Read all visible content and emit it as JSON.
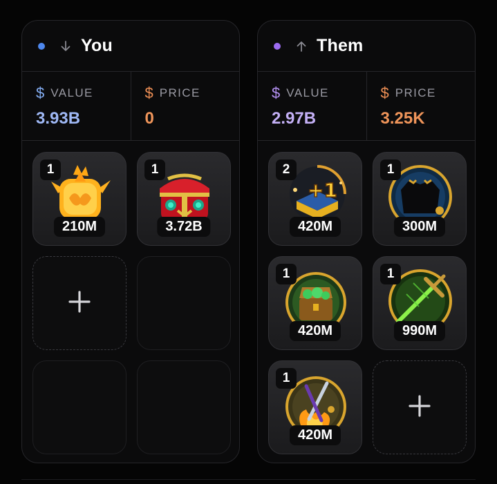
{
  "you": {
    "title": "You",
    "dot_color": "#4e88ee",
    "arrow_icon": "arrow-down-icon",
    "value_label": "VALUE",
    "price_label": "PRICE",
    "currency_symbol": "$",
    "value": "3.93B",
    "price": "0",
    "items": [
      {
        "qty": "1",
        "value": "210M",
        "icon": "flame-fruit-icon"
      },
      {
        "qty": "1",
        "value": "3.72B",
        "icon": "red-chest-icon"
      }
    ]
  },
  "them": {
    "title": "Them",
    "dot_color": "#9d6cf2",
    "arrow_icon": "arrow-up-icon",
    "value_label": "VALUE",
    "price_label": "PRICE",
    "currency_symbol": "$",
    "value": "2.97B",
    "price": "3.25K",
    "items": [
      {
        "qty": "2",
        "value": "420M",
        "icon": "plus-one-chest-icon"
      },
      {
        "qty": "1",
        "value": "300M",
        "icon": "dark-coat-icon"
      },
      {
        "qty": "1",
        "value": "420M",
        "icon": "treasure-chest-icon"
      },
      {
        "qty": "1",
        "value": "990M",
        "icon": "green-sword-icon"
      },
      {
        "qty": "1",
        "value": "420M",
        "icon": "flame-swords-icon"
      }
    ]
  },
  "colors": {
    "value_you": "#9fb8f5",
    "value_them": "#c4b0f6",
    "price": "#f0955a",
    "value_icon": "#84aef4",
    "price_icon": "#ee8f55"
  }
}
